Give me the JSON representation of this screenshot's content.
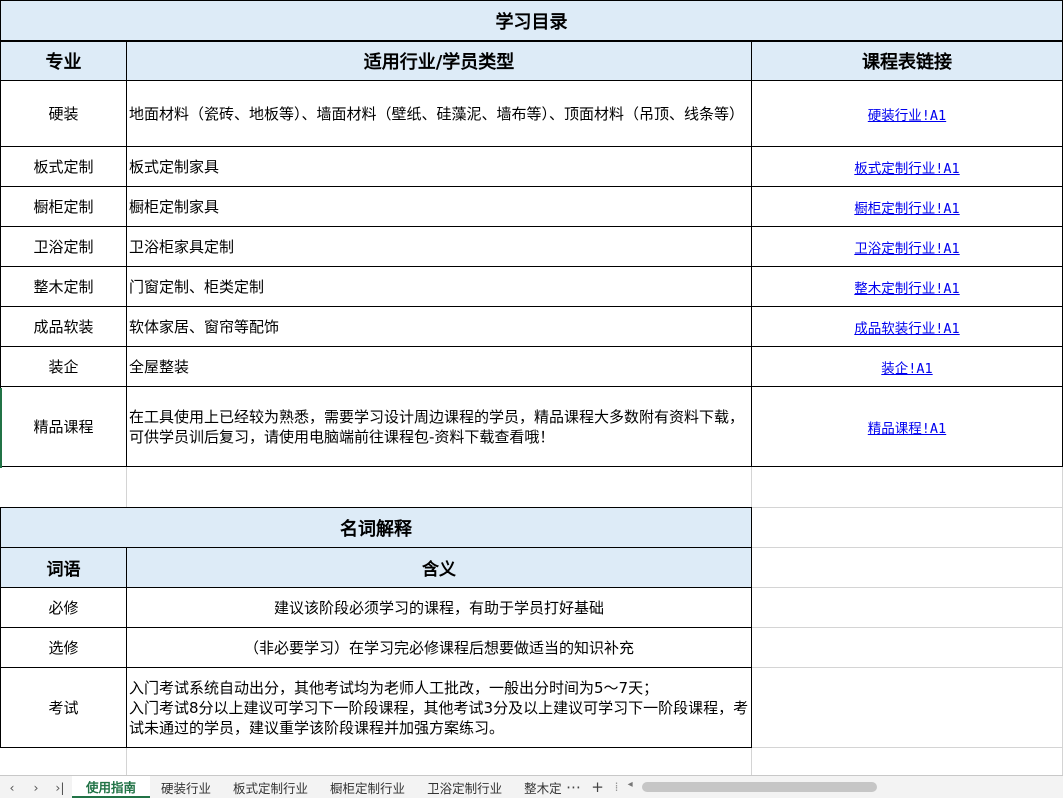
{
  "catalog": {
    "title": "学习目录",
    "headers": {
      "major": "专业",
      "industry": "适用行业/学员类型",
      "link": "课程表链接"
    },
    "rows": [
      {
        "major": "硬装",
        "desc": "地面材料（瓷砖、地板等）、墙面材料（壁纸、硅藻泥、墙布等）、顶面材料（吊顶、线条等）",
        "link": "硬装行业!A1"
      },
      {
        "major": "板式定制",
        "desc": "板式定制家具",
        "link": "板式定制行业!A1"
      },
      {
        "major": "橱柜定制",
        "desc": "橱柜定制家具",
        "link": "橱柜定制行业!A1"
      },
      {
        "major": "卫浴定制",
        "desc": "卫浴柜家具定制",
        "link": "卫浴定制行业!A1"
      },
      {
        "major": "整木定制",
        "desc": "门窗定制、柜类定制",
        "link": "整木定制行业!A1"
      },
      {
        "major": "成品软装",
        "desc": "软体家居、窗帘等配饰",
        "link": "成品软装行业!A1"
      },
      {
        "major": "装企",
        "desc": "全屋整装",
        "link": "装企!A1"
      },
      {
        "major": "精品课程",
        "desc": "在工具使用上已经较为熟悉，需要学习设计周边课程的学员，精品课程大多数附有资料下载，可供学员训后复习，请使用电脑端前往课程包-资料下载查看哦！",
        "link": "精品课程!A1"
      }
    ]
  },
  "glossary": {
    "title": "名词解释",
    "headers": {
      "term": "词语",
      "meaning": "含义"
    },
    "rows": [
      {
        "term": "必修",
        "meaning": "建议该阶段必须学习的课程，有助于学员打好基础"
      },
      {
        "term": "选修",
        "meaning": "（非必要学习）在学习完必修课程后想要做适当的知识补充"
      },
      {
        "term": "考试",
        "meaning_line1": "入门考试系统自动出分，其他考试均为老师人工批改，一般出分时间为5～7天；",
        "meaning_line2": "入门考试8分以上建议可学习下一阶段课程，其他考试3分及以上建议可学习下一阶段课程，考试未通过的学员，建议重学该阶段课程并加强方案练习。"
      }
    ]
  },
  "tabs": {
    "items": [
      "使用指南",
      "硬装行业",
      "板式定制行业",
      "橱柜定制行业",
      "卫浴定制行业",
      "整木定"
    ],
    "active_index": 0,
    "more": "⋯",
    "add": "+"
  },
  "colors": {
    "header_bg": "#ddebf7",
    "link": "#0000ee",
    "active_tab": "#217346"
  }
}
